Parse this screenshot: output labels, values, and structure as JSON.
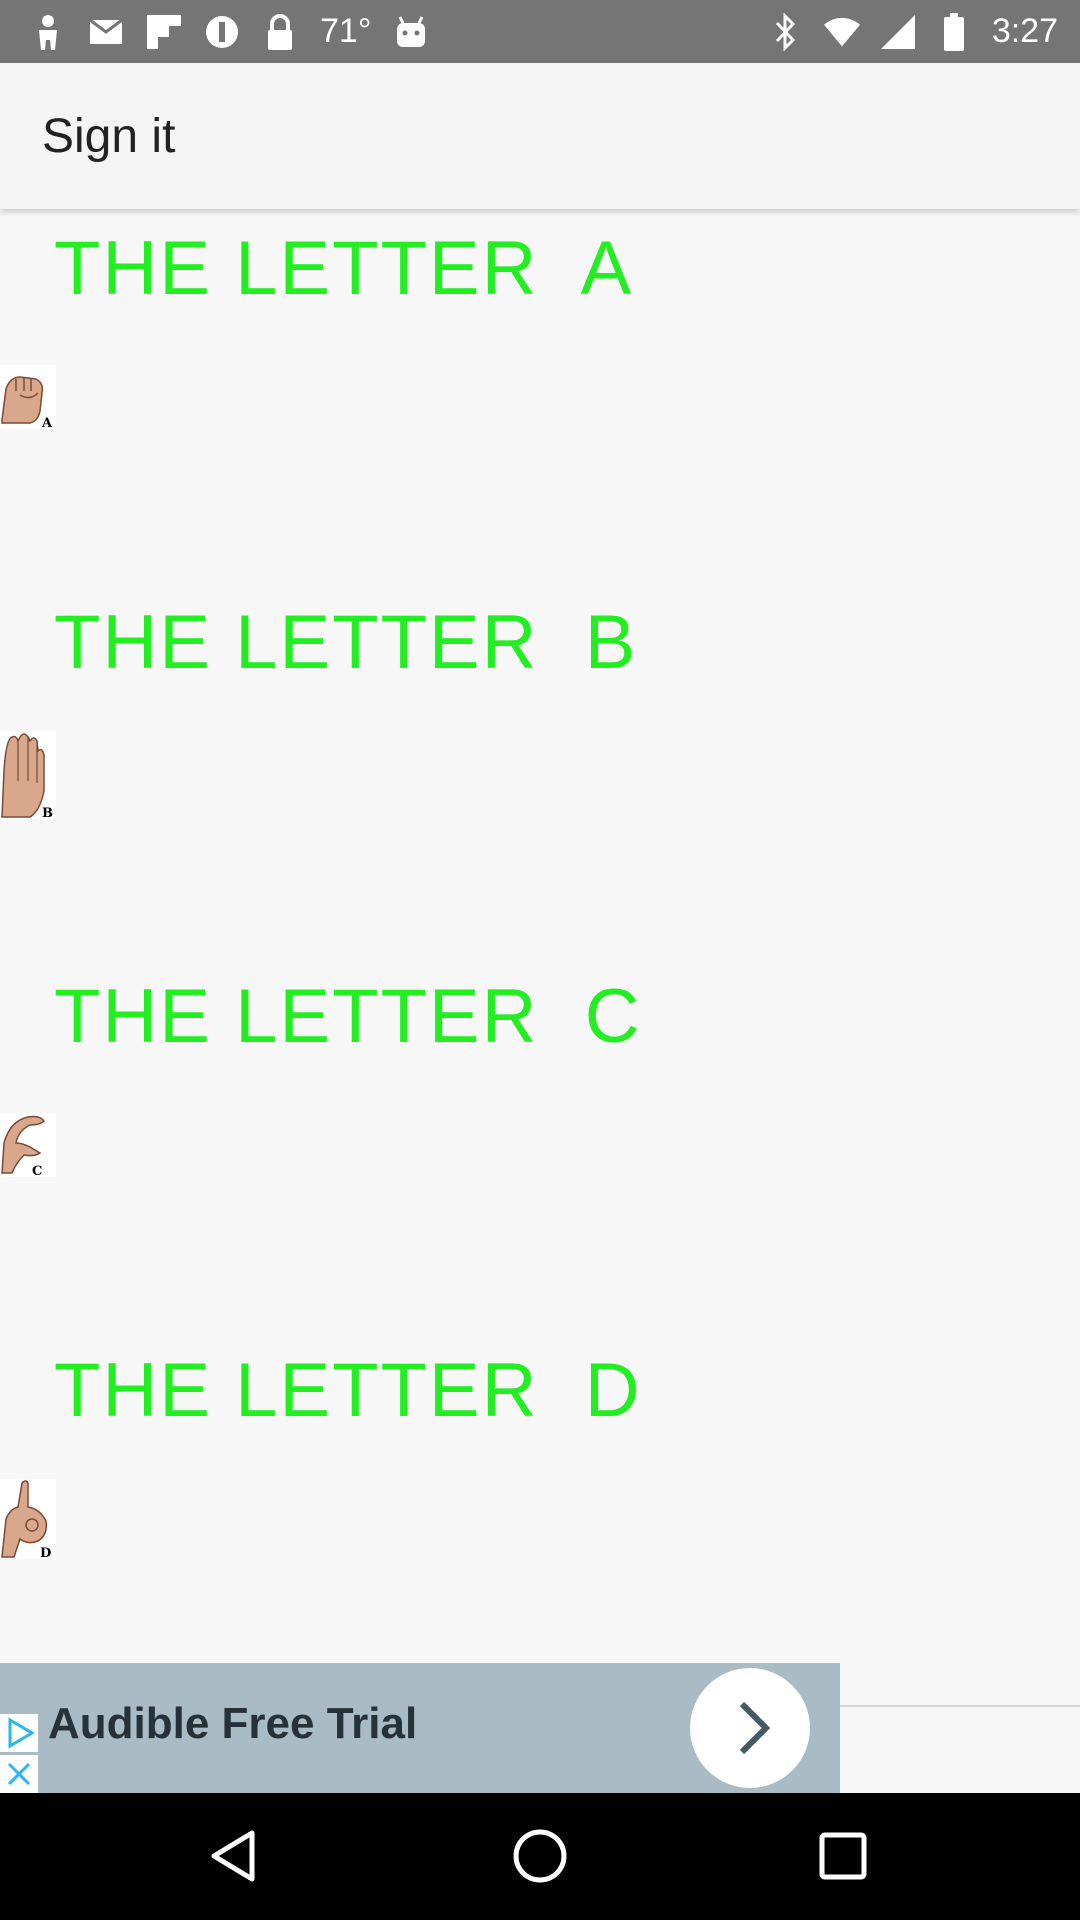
{
  "status_bar": {
    "temperature": "71°",
    "time": "3:27",
    "left_icons": [
      "notification-icon",
      "mail-icon",
      "flipboard-icon",
      "info-icon",
      "lock-icon"
    ],
    "right_icons": [
      "bluetooth-icon",
      "wifi-icon",
      "signal-icon",
      "battery-icon"
    ]
  },
  "app_bar": {
    "title": "Sign it"
  },
  "items": [
    {
      "title": "THE LETTER  A",
      "hand_caption": "A"
    },
    {
      "title": "THE LETTER  B",
      "hand_caption": "B"
    },
    {
      "title": "THE LETTER  C",
      "hand_caption": "C"
    },
    {
      "title": "THE LETTER  D",
      "hand_caption": "D"
    }
  ],
  "ad": {
    "text": "Audible Free Trial",
    "accent": "#29b6f6"
  },
  "colors": {
    "letter_title": "#22ee22",
    "status_bar": "#757575",
    "ad_banner": "#a9bcc5"
  },
  "nav": {
    "buttons": [
      "back-icon",
      "home-icon",
      "recents-icon"
    ]
  }
}
